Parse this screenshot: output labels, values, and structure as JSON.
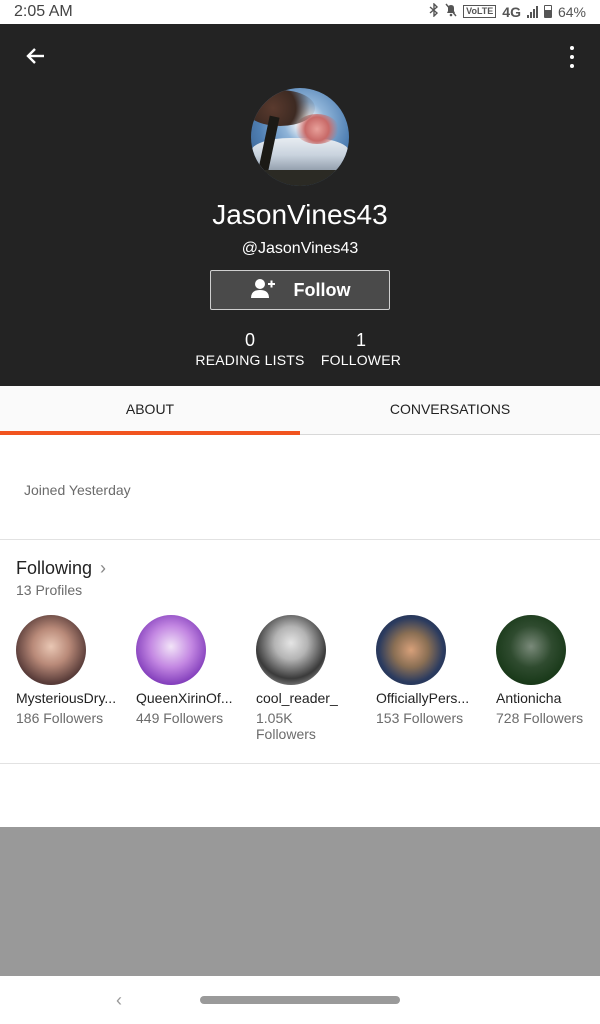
{
  "status_bar": {
    "time": "2:05 AM",
    "network": "4G",
    "volte": "VoLTE",
    "battery": "64%"
  },
  "header": {
    "name": "JasonVines43",
    "handle": "@JasonVines43",
    "follow_label": "Follow",
    "stats": [
      {
        "value": "0",
        "label": "READING LISTS"
      },
      {
        "value": "1",
        "label": "FOLLOWER"
      }
    ]
  },
  "tabs": [
    {
      "label": "ABOUT",
      "active": true
    },
    {
      "label": "CONVERSATIONS",
      "active": false
    }
  ],
  "about": {
    "joined": "Joined Yesterday"
  },
  "following": {
    "title": "Following",
    "count": "13 Profiles",
    "profiles": [
      {
        "name": "MysteriousDry...",
        "followers": "186 Followers"
      },
      {
        "name": "QueenXirinOf...",
        "followers": "449 Followers"
      },
      {
        "name": "cool_reader_",
        "followers": "1.05K Followers"
      },
      {
        "name": "OfficiallyPers...",
        "followers": "153 Followers"
      },
      {
        "name": "Antionicha",
        "followers": "728 Followers"
      }
    ]
  },
  "colors": {
    "header_bg": "#232323",
    "accent": "#f1541f",
    "follow_bg": "#4a4a4a",
    "gray_panel": "#999999"
  }
}
